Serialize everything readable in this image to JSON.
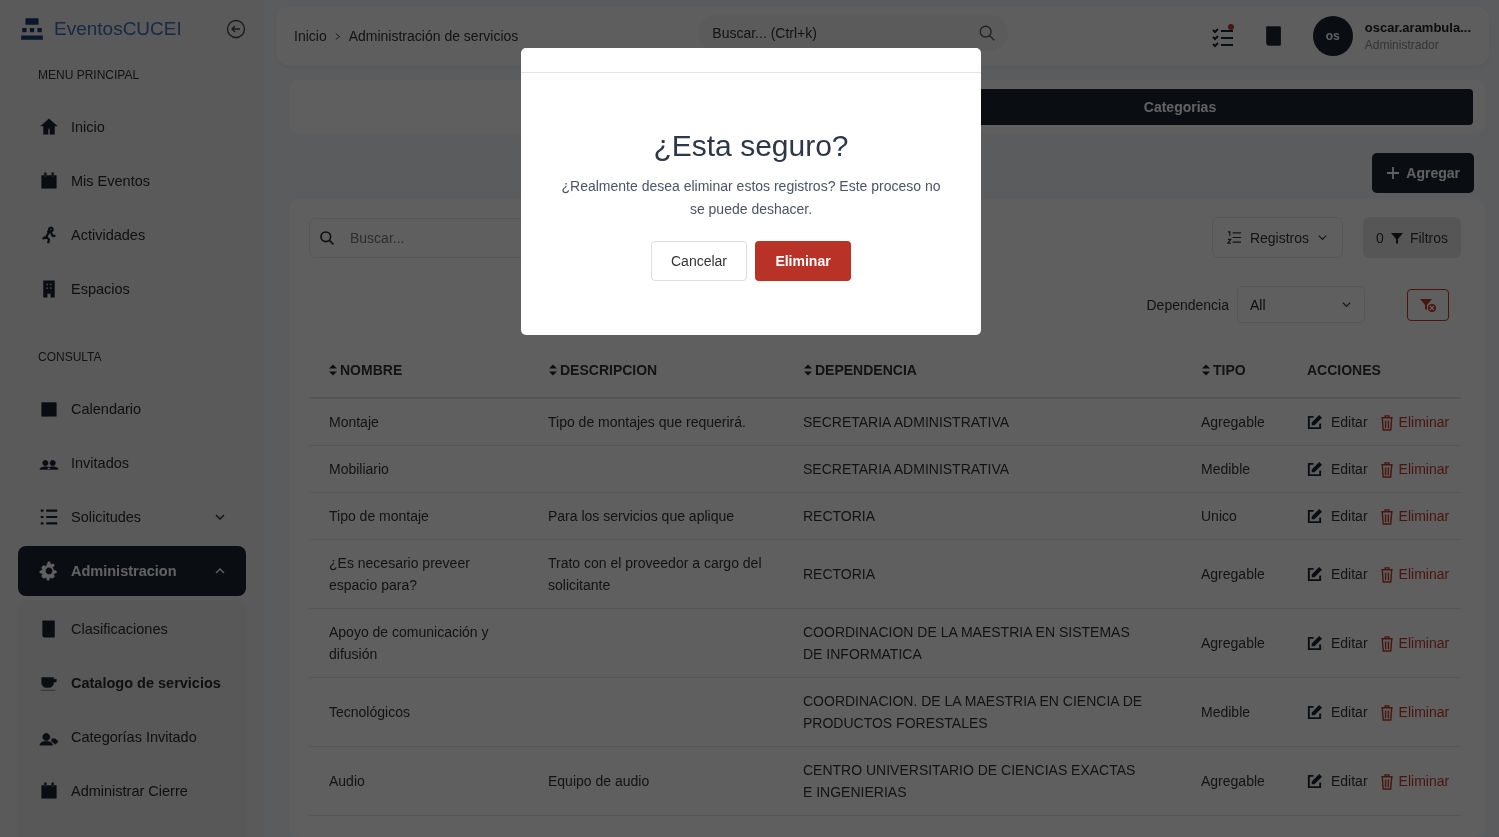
{
  "sidebar": {
    "logo": "EventosCUCEI",
    "sections": [
      {
        "title": "MENU PRINCIPAL",
        "items": [
          {
            "label": "Inicio",
            "selected": false
          },
          {
            "label": "Mis Eventos",
            "selected": false
          },
          {
            "label": "Actividades",
            "selected": false
          },
          {
            "label": "Espacios",
            "selected": false
          }
        ]
      },
      {
        "title": "CONSULTA",
        "items": [
          {
            "label": "Calendario",
            "selected": false
          },
          {
            "label": "Invitados",
            "selected": false
          },
          {
            "label": "Solicitudes",
            "selected": false,
            "expanded": false
          },
          {
            "label": "Administracion",
            "selected": true,
            "expanded": true,
            "children": [
              {
                "label": "Clasificaciones",
                "selected": false
              },
              {
                "label": "Catalogo de servicios",
                "selected": true
              },
              {
                "label": "Categorías Invitado",
                "selected": false
              },
              {
                "label": "Administrar Cierre",
                "selected": false
              }
            ]
          }
        ]
      }
    ]
  },
  "header": {
    "breadcrumb": [
      "Inicio",
      "Administración de servicios"
    ],
    "search": {
      "placeholder": "Buscar... (Ctrl+k)"
    },
    "notification": true,
    "user": {
      "initials": "os",
      "name": "oscar.arambula...",
      "role": "Administrador"
    }
  },
  "tabs": [
    {
      "label": "Categorias",
      "selected": true
    }
  ],
  "add_button": "Agregar",
  "toolbar": {
    "search": {
      "placeholder": "Buscar..."
    },
    "records_button": "Registros",
    "filters_count": "0",
    "filters_button": "Filtros",
    "filter_label": "Dependencia",
    "filter_value": "All"
  },
  "table": {
    "columns": [
      "NOMBRE",
      "DESCRIPCION",
      "DEPENDENCIA",
      "TIPO",
      "ACCIONES"
    ],
    "rows": [
      {
        "nombre": "Montaje",
        "descripcion": "Tipo de montajes que requerirá.",
        "dependencia": "SECRETARIA ADMINISTRATIVA",
        "tipo": "Agregable",
        "edit": "Editar",
        "delete": "Eliminar"
      },
      {
        "nombre": "Mobiliario",
        "descripcion": "",
        "dependencia": "SECRETARIA ADMINISTRATIVA",
        "tipo": "Medible",
        "edit": "Editar",
        "delete": "Eliminar"
      },
      {
        "nombre": "Tipo de montaje",
        "descripcion": "Para los servicios que aplique",
        "dependencia": "RECTORIA",
        "tipo": "Unico",
        "edit": "Editar",
        "delete": "Eliminar"
      },
      {
        "nombre": "¿Es necesario preveer espacio para?",
        "descripcion": "Trato con el proveedor a cargo del solicitante",
        "dependencia": "RECTORIA",
        "tipo": "Agregable",
        "edit": "Editar",
        "delete": "Eliminar"
      },
      {
        "nombre": "Apoyo de comunicación y difusión",
        "descripcion": "",
        "dependencia": "COORDINACION DE LA MAESTRIA EN SISTEMAS DE INFORMATICA",
        "tipo": "Agregable",
        "edit": "Editar",
        "delete": "Eliminar"
      },
      {
        "nombre": "Tecnológicos",
        "descripcion": "",
        "dependencia": "COORDINACION. DE LA MAESTRIA EN CIENCIA DE PRODUCTOS FORESTALES",
        "tipo": "Medible",
        "edit": "Editar",
        "delete": "Eliminar"
      },
      {
        "nombre": "Audio",
        "descripcion": "Equipo de audio",
        "dependencia": "CENTRO UNIVERSITARIO DE CIENCIAS EXACTAS E INGENIERIAS",
        "tipo": "Agregable",
        "edit": "Editar",
        "delete": "Eliminar"
      }
    ]
  },
  "dialog": {
    "open": true,
    "title": "¿Esta seguro?",
    "message": "¿Realmente desea eliminar estos registros? Este proceso no se puede deshacer.",
    "cancel": "Cancelar",
    "confirm": "Eliminar"
  }
}
